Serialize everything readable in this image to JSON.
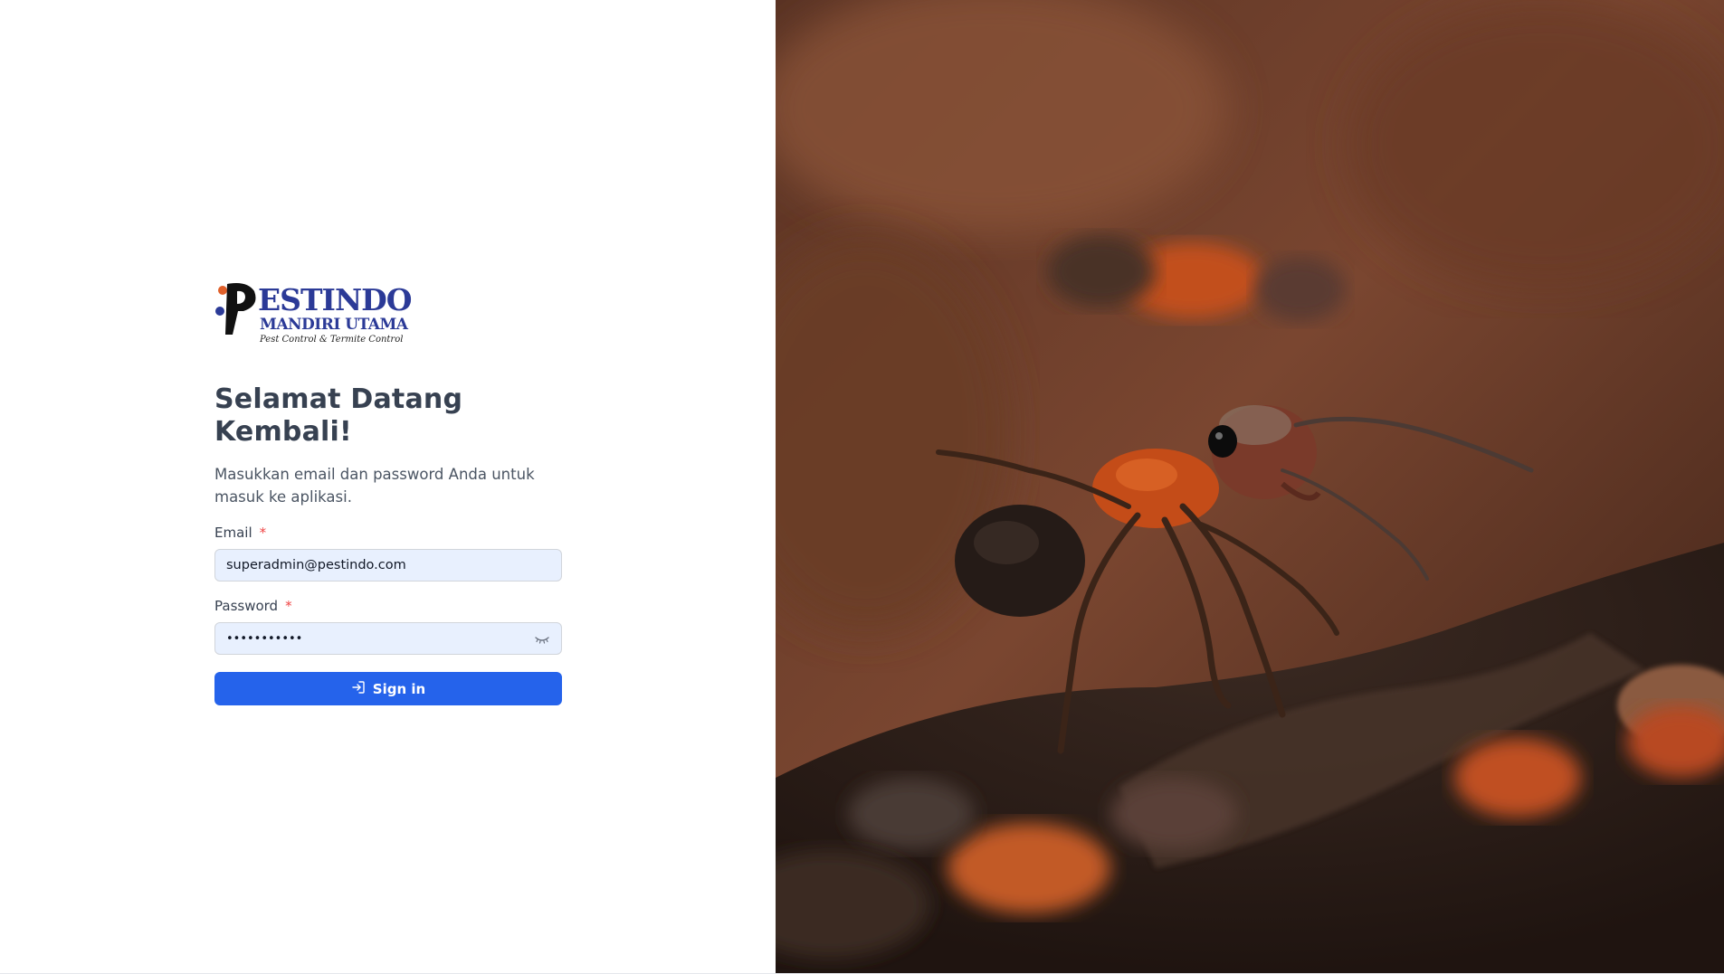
{
  "brand": {
    "logo_line1": "PESTINDO",
    "logo_line2": "MANDIRI UTAMA",
    "logo_tagline": "Pest Control & Termite Control",
    "colors": {
      "logo_blue": "#2b3a97",
      "logo_orange": "#e0602a",
      "primary_button": "#2563eb",
      "required_star": "#ef4444",
      "input_autofill_bg": "#e8f0fe"
    }
  },
  "login": {
    "heading": "Selamat Datang Kembali!",
    "subtitle": "Masukkan email dan password Anda untuk masuk ke aplikasi.",
    "email": {
      "label": "Email",
      "required_mark": "*",
      "value": "superadmin@pestindo.com"
    },
    "password": {
      "label": "Password",
      "required_mark": "*",
      "value": "•••••••••••",
      "toggle_icon": "eye-closed-icon"
    },
    "submit": {
      "label": "Sign in",
      "icon": "sign-in-icon"
    }
  },
  "hero_image": {
    "subject": "ant-photo"
  }
}
